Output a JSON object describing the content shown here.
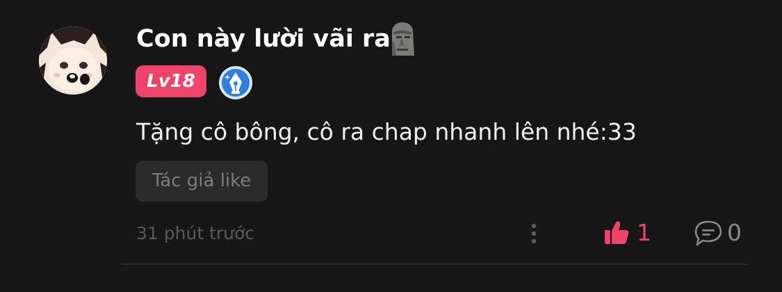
{
  "comment": {
    "username": "Con này lười vãi ra",
    "username_emoji": "moai-icon",
    "level": "Lv18",
    "content": "Tặng cô bông, cô ra chap nhanh lên nhé:33",
    "author_like_label": "Tác giả like",
    "timestamp": "31 phút trước",
    "like_count": "1",
    "reply_count": "0"
  },
  "colors": {
    "background": "#171617",
    "accent": "#f0436a",
    "badge_blue": "#2f7fe0",
    "muted": "#59595a"
  },
  "icons": [
    "avatar",
    "moai-icon",
    "pen-nib-badge-icon",
    "more-dots-icon",
    "thumbs-up-icon",
    "comment-bubble-icon"
  ]
}
